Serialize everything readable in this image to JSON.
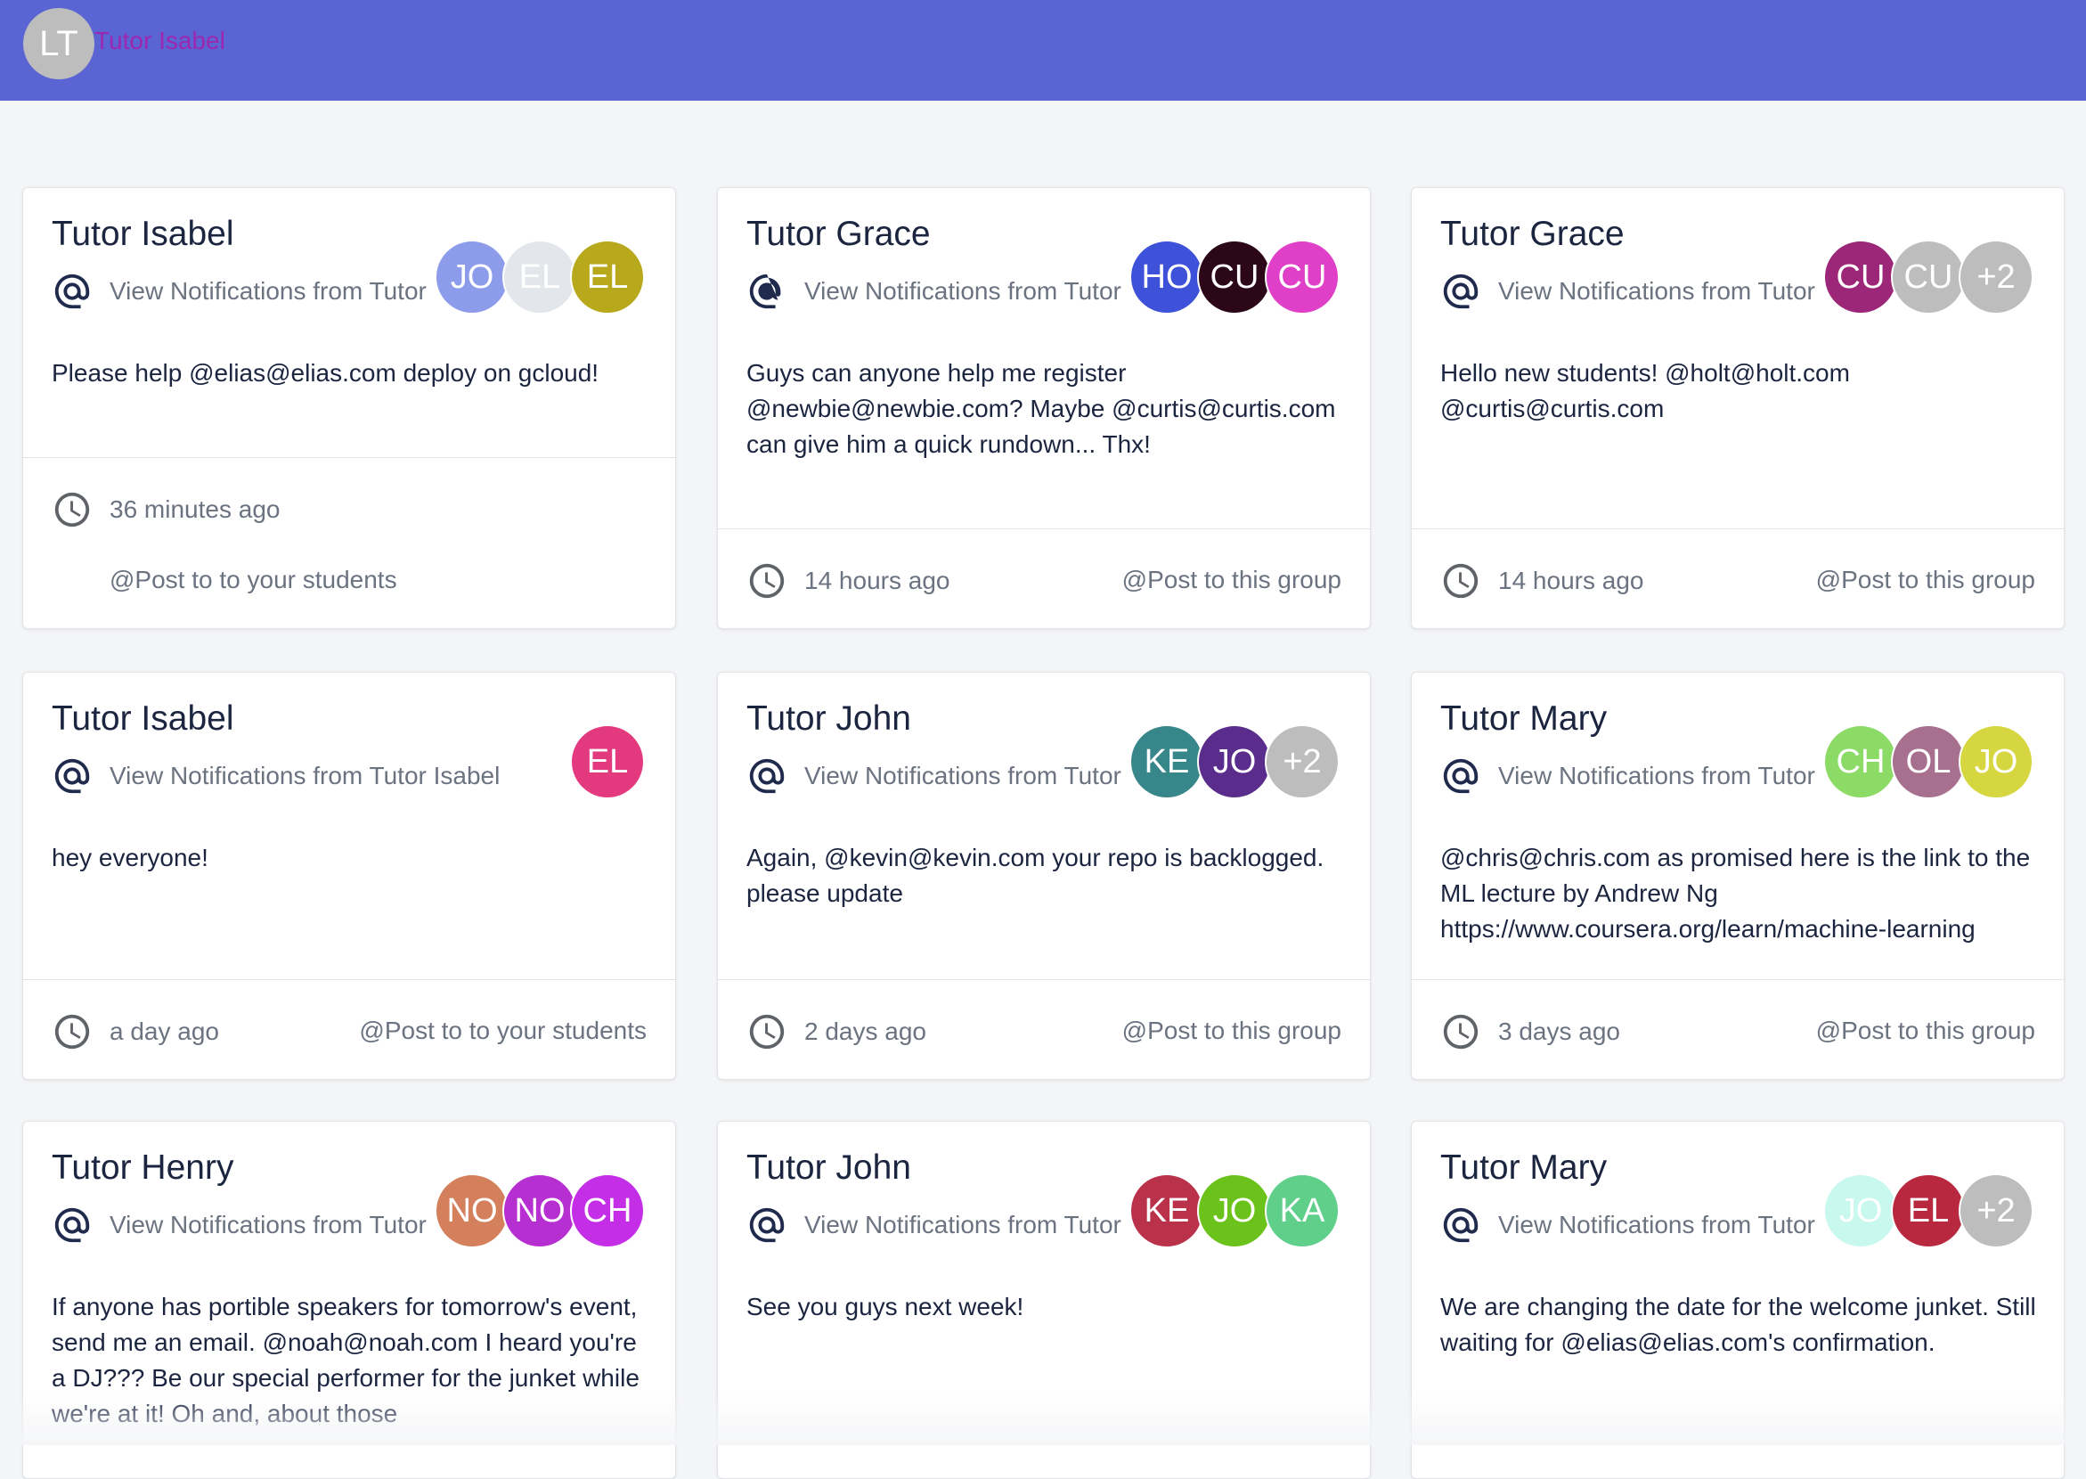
{
  "header": {
    "avatar_initials": "LT",
    "user_name": "Tutor Isabel"
  },
  "cards": [
    {
      "title": "Tutor Isabel",
      "subtitle": "View Notifications from Tutor",
      "avatars": [
        {
          "initials": "JO",
          "color": "#8c9ceb"
        },
        {
          "initials": "EL",
          "color": "#e3e7ec"
        },
        {
          "initials": "EL",
          "color": "#b8a81c"
        }
      ],
      "body": "Please help @elias@elias.com deploy on gcloud!",
      "time": "36 minutes ago",
      "post": "@Post to to your students"
    },
    {
      "title": "Tutor Grace",
      "subtitle": "View Notifications from Tutor",
      "avatars": [
        {
          "initials": "HO",
          "color": "#3d52d8"
        },
        {
          "initials": "CU",
          "color": "#2b0718"
        },
        {
          "initials": "CU",
          "color": "#e040c8"
        }
      ],
      "body": "Guys can anyone help me register @newbie@newbie.com? Maybe @curtis@curtis.com can give him a quick rundown... Thx!",
      "time": "14 hours ago",
      "post": "@Post to this group"
    },
    {
      "title": "Tutor Grace",
      "subtitle": "View Notifications from Tutor",
      "avatars": [
        {
          "initials": "CU",
          "color": "#9c2677"
        },
        {
          "initials": "CU",
          "color": "#bdbdbd"
        },
        {
          "initials": "+2",
          "color": "#bdbdbd"
        }
      ],
      "body": "Hello new students! @holt@holt.com @curtis@curtis.com",
      "time": "14 hours ago",
      "post": "@Post to this group"
    },
    {
      "title": "Tutor Isabel",
      "subtitle": "View Notifications from Tutor Isabel",
      "avatars": [
        {
          "initials": "EL",
          "color": "#e33a7f"
        }
      ],
      "body": "hey everyone!",
      "time": "a day ago",
      "post": "@Post to to your students"
    },
    {
      "title": "Tutor John",
      "subtitle": "View Notifications from Tutor",
      "avatars": [
        {
          "initials": "KE",
          "color": "#37868a"
        },
        {
          "initials": "JO",
          "color": "#5a2c8c"
        },
        {
          "initials": "+2",
          "color": "#bdbdbd"
        }
      ],
      "body": "Again, @kevin@kevin.com your repo is backlogged. please update",
      "time": "2 days ago",
      "post": "@Post to this group"
    },
    {
      "title": "Tutor Mary",
      "subtitle": "View Notifications from Tutor",
      "avatars": [
        {
          "initials": "CH",
          "color": "#8cdb66"
        },
        {
          "initials": "OL",
          "color": "#a6708e"
        },
        {
          "initials": "JO",
          "color": "#d6d640"
        }
      ],
      "body": "@chris@chris.com as promised here is the link to the ML lecture by Andrew Ng https://www.coursera.org/learn/machine-learning",
      "time": "3 days ago",
      "post": "@Post to this group"
    },
    {
      "title": "Tutor Henry",
      "subtitle": "View Notifications from Tutor",
      "avatars": [
        {
          "initials": "NO",
          "color": "#d5805c"
        },
        {
          "initials": "NO",
          "color": "#b62fd1"
        },
        {
          "initials": "CH",
          "color": "#c32ee6"
        }
      ],
      "body": "If anyone has portible speakers for tomorrow's event, send me an email. @noah@noah.com I heard you're a DJ??? Be our special performer for the junket while we're at it! Oh and, about those",
      "time": "",
      "post": ""
    },
    {
      "title": "Tutor John",
      "subtitle": "View Notifications from Tutor",
      "avatars": [
        {
          "initials": "KE",
          "color": "#b9324a"
        },
        {
          "initials": "JO",
          "color": "#6bc21a"
        },
        {
          "initials": "KA",
          "color": "#5fcf8a"
        }
      ],
      "body": "See you guys next week!",
      "time": "",
      "post": ""
    },
    {
      "title": "Tutor Mary",
      "subtitle": "View Notifications from Tutor",
      "avatars": [
        {
          "initials": "JO",
          "color": "#c8f8ee"
        },
        {
          "initials": "EL",
          "color": "#b8293f"
        },
        {
          "initials": "+2",
          "color": "#bdbdbd"
        }
      ],
      "body": "We are changing the date for the welcome junket. Still waiting for @elias@elias.com's confirmation.",
      "time": "",
      "post": ""
    }
  ]
}
